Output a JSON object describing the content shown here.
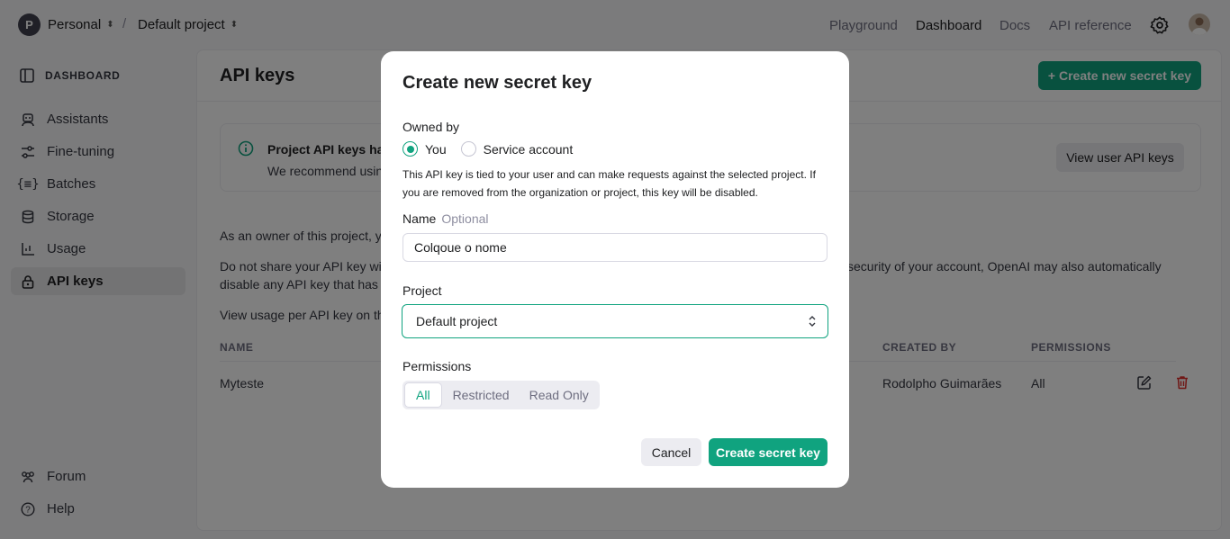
{
  "topbar": {
    "org_initial": "P",
    "org_name": "Personal",
    "separator": "/",
    "project_name": "Default project",
    "nav": [
      "Playground",
      "Dashboard",
      "Docs",
      "API reference"
    ],
    "active_nav": "Dashboard"
  },
  "sidebar": {
    "heading": "DASHBOARD",
    "items": [
      {
        "label": "Assistants",
        "icon": "assistant-icon"
      },
      {
        "label": "Fine-tuning",
        "icon": "sliders-icon"
      },
      {
        "label": "Batches",
        "icon": "braces-icon"
      },
      {
        "label": "Storage",
        "icon": "database-icon"
      },
      {
        "label": "Usage",
        "icon": "chart-icon"
      },
      {
        "label": "API keys",
        "icon": "lock-icon"
      }
    ],
    "active_item": "API keys",
    "footer": [
      {
        "label": "Forum",
        "icon": "people-icon"
      },
      {
        "label": "Help",
        "icon": "help-icon"
      }
    ]
  },
  "main": {
    "title": "API keys",
    "create_button": "+ Create new secret key",
    "notice": {
      "title": "Project API keys hav",
      "body": "We recommend usin",
      "button": "View user API keys"
    },
    "para1": "As an owner of this project, yo",
    "para2_line1_left": "Do not share your API key wit",
    "para2_line1_right": "security of your account, OpenAI may also automatically",
    "para2_line2": "disable any API key that has l",
    "para3": "View usage per API key on th",
    "table": {
      "headers": [
        "NAME",
        "CREATED BY",
        "PERMISSIONS"
      ],
      "rows": [
        {
          "name": "Myteste",
          "created_by": "Rodolpho Guimarães",
          "permissions": "All"
        }
      ]
    }
  },
  "modal": {
    "title": "Create new secret key",
    "owned_by_label": "Owned by",
    "owner_options": [
      "You",
      "Service account"
    ],
    "owner_selected": "You",
    "owner_help": "This API key is tied to your user and can make requests against the selected project. If you are removed from the organization or project, this key will be disabled.",
    "name_label": "Name",
    "name_optional": "Optional",
    "name_value": "Colqoue o nome",
    "project_label": "Project",
    "project_value": "Default project",
    "permissions_label": "Permissions",
    "permission_options": [
      "All",
      "Restricted",
      "Read Only"
    ],
    "permission_selected": "All",
    "cancel_label": "Cancel",
    "submit_label": "Create secret key"
  },
  "colors": {
    "accent": "#10a37f",
    "danger": "#e02e2a"
  }
}
